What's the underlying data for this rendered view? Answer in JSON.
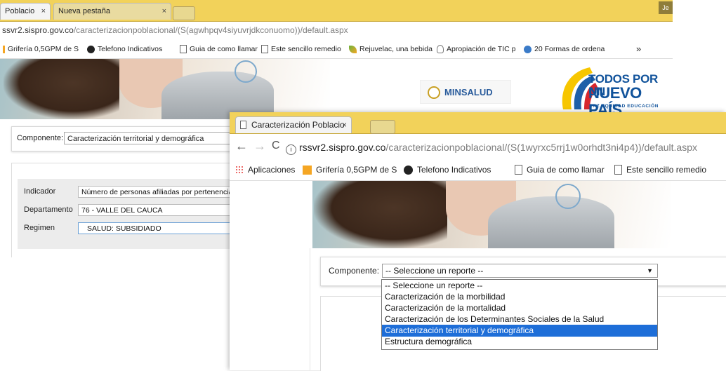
{
  "back_window": {
    "tabs": [
      {
        "label": "Poblacio"
      },
      {
        "label": "Nueva pestaña"
      }
    ],
    "close_glyph": "×",
    "user_initial": "Je",
    "address": {
      "host": "ssvr2.sispro.gov.co",
      "path": "/caracterizacionpoblacional/(S(agwhpqv4siyuvrjdkconuomo))/default.aspx"
    },
    "bookmarks": [
      {
        "label": "Grifería 0,5GPM de S",
        "icon": "yellow-square-icon"
      },
      {
        "label": "Telefono Indicativos",
        "icon": "dark-circle-icon"
      },
      {
        "label": "Guia de como llamar",
        "icon": "page-icon"
      },
      {
        "label": "Este sencillo remedio",
        "icon": "page-icon"
      },
      {
        "label": "Rejuvelac, una bebida",
        "icon": "leaf-icon"
      },
      {
        "label": "Apropiación de TIC p",
        "icon": "bulb-icon"
      },
      {
        "label": "20 Formas de ordena",
        "icon": "globe-icon"
      }
    ],
    "bookmarks_overflow": "»",
    "logos": {
      "minsalud": "MINSALUD",
      "todos_line1": "TODOS POR UN",
      "todos_line2": "NUEVO PAÍS",
      "todos_line3": "PAZ  EQUIDAD  EDUCACIÓN"
    },
    "componente": {
      "label": "Componente:",
      "value": "Caracterización territorial y demográfica"
    },
    "filters": [
      {
        "label": "Indicador",
        "value": "Número de personas afiliadas por pertenencia"
      },
      {
        "label": "Departamento",
        "value": "76 - VALLE DEL CAUCA"
      },
      {
        "label": "Regimen",
        "value": "SALUD: SUBSIDIADO"
      }
    ]
  },
  "front_window": {
    "tab": {
      "label": "Caracterización Poblacio",
      "close": "×"
    },
    "nav": {
      "back": "←",
      "forward": "→",
      "reload": "C",
      "info": "i"
    },
    "address": {
      "host": "rssvr2.sispro.gov.co",
      "path": "/caracterizacionpoblacional/(S(1wyrxc5rrj1w0orhdt3ni4p4))/default.aspx"
    },
    "bookmarks": [
      {
        "label": "Aplicaciones",
        "icon": "apps-grid-icon"
      },
      {
        "label": "Grifería 0,5GPM de S",
        "icon": "yellow-square-icon"
      },
      {
        "label": "Telefono Indicativos",
        "icon": "dark-circle-icon"
      },
      {
        "label": "Guia de como llamar",
        "icon": "page-icon"
      },
      {
        "label": "Este sencillo remedio",
        "icon": "page-icon"
      }
    ],
    "componente": {
      "label": "Componente:",
      "value": "-- Seleccione un reporte --",
      "arrow": "▼"
    },
    "dropdown_options": [
      "-- Seleccione un reporte --",
      "Caracterización de la morbilidad",
      "Caracterización de la mortalidad",
      "Caracterización de los Determinantes Sociales de la Salud",
      "Caracterización territorial y demográfica",
      "Estructura demográfica"
    ],
    "dropdown_selected_index": 4,
    "colors": {
      "tabbar": "#f2d25a",
      "selection": "#1e6ed8"
    }
  }
}
